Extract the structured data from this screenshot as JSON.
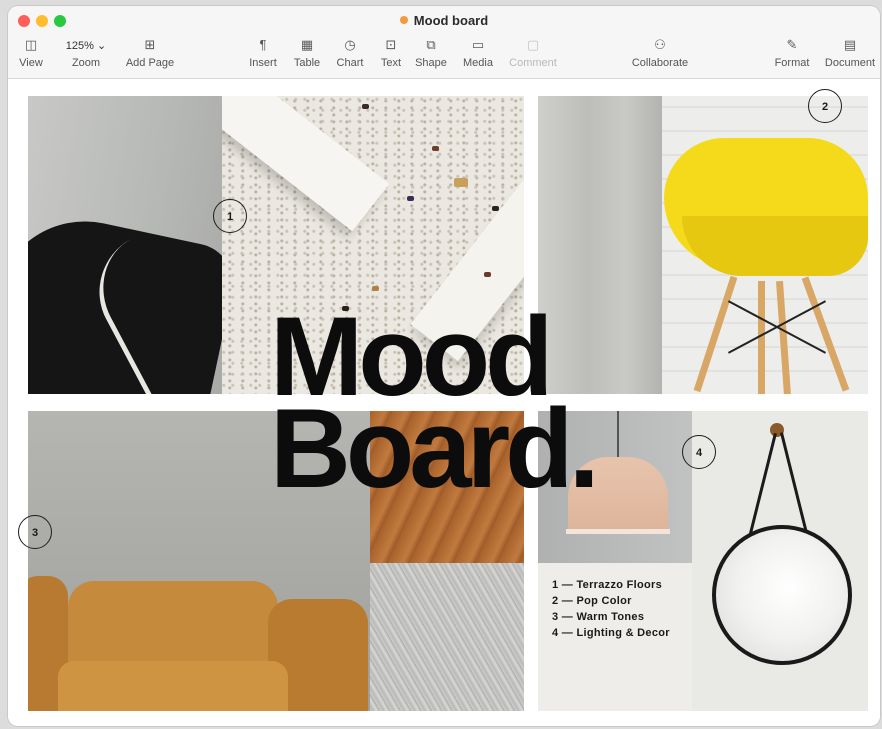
{
  "window": {
    "title": "Mood board"
  },
  "toolbar": {
    "items": [
      {
        "label": "View",
        "icon": "sidebar-icon"
      },
      {
        "label": "Zoom",
        "value": "125%",
        "icon": "chevron-down-icon"
      },
      {
        "label": "Add Page",
        "icon": "add-page-icon"
      },
      {
        "label": "Insert",
        "icon": "paragraph-icon"
      },
      {
        "label": "Table",
        "icon": "table-icon"
      },
      {
        "label": "Chart",
        "icon": "chart-icon"
      },
      {
        "label": "Text",
        "icon": "text-box-icon"
      },
      {
        "label": "Shape",
        "icon": "shape-icon"
      },
      {
        "label": "Media",
        "icon": "media-icon"
      },
      {
        "label": "Comment",
        "icon": "comment-icon",
        "disabled": true
      },
      {
        "label": "Collaborate",
        "icon": "collaborate-icon"
      },
      {
        "label": "Format",
        "icon": "format-brush-icon"
      },
      {
        "label": "Document",
        "icon": "document-icon"
      }
    ]
  },
  "document": {
    "headline_line1": "Mood",
    "headline_line2": "Board.",
    "markers": [
      "1",
      "2",
      "3",
      "4"
    ],
    "legend": [
      {
        "num": "1",
        "dash": "—",
        "text": "Terrazzo Floors"
      },
      {
        "num": "2",
        "dash": "—",
        "text": "Pop Color"
      },
      {
        "num": "3",
        "dash": "—",
        "text": "Warm Tones"
      },
      {
        "num": "4",
        "dash": "—",
        "text": "Lighting & Decor"
      }
    ]
  },
  "colors": {
    "accent_dot": "#f29a3c",
    "close": "#ff5f57",
    "minimize": "#febc2e",
    "zoom": "#28c840"
  }
}
